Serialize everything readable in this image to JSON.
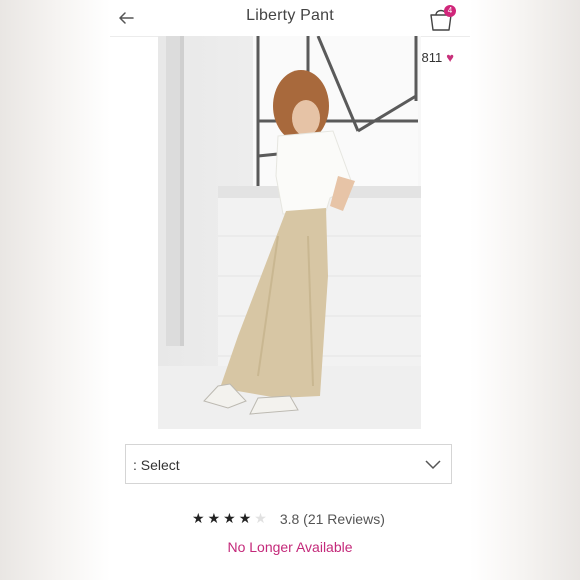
{
  "header": {
    "title": "Liberty Pant",
    "bag_count": "4"
  },
  "product": {
    "likes": "811",
    "select_label": ": Select",
    "rating_value": "3.8",
    "review_count_text": "(21 Reviews)",
    "stars_filled": 4,
    "stars_total": 5,
    "availability": "No Longer Available"
  },
  "colors": {
    "accent": "#c8317b",
    "badge": "#d0267a",
    "text": "#333333"
  },
  "icons": [
    "back-arrow-icon",
    "shopping-bag-icon",
    "heart-icon",
    "chevron-down-icon",
    "star-icon"
  ]
}
